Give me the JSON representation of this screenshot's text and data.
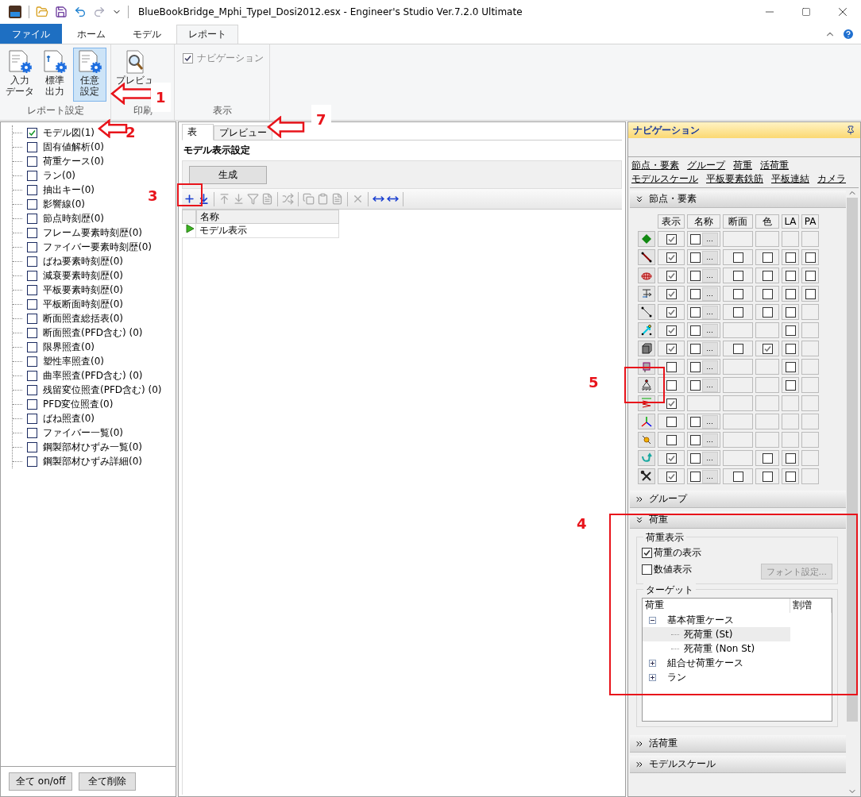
{
  "window": {
    "title": "BlueBookBridge_Mphi_TypeI_Dosi2012.esx - Engineer's Studio Ver.7.2.0 Ultimate"
  },
  "ribbon": {
    "tabs": [
      {
        "label": "ファイル",
        "kind": "file",
        "selected": false
      },
      {
        "label": "ホーム",
        "kind": "tab",
        "selected": false
      },
      {
        "label": "モデル",
        "kind": "tab",
        "selected": false
      },
      {
        "label": "レポート",
        "kind": "tab",
        "selected": true
      }
    ],
    "groups": [
      {
        "label": "レポート設定",
        "kind": "buttons",
        "buttons": [
          {
            "lines": [
              "入力",
              "データ"
            ],
            "selected": false
          },
          {
            "lines": [
              "標準",
              "出力"
            ],
            "selected": false
          },
          {
            "lines": [
              "任意",
              "設定"
            ],
            "selected": true
          }
        ]
      },
      {
        "label": "印刷",
        "kind": "buttons",
        "buttons": [
          {
            "lines": [
              "プレビュ"
            ],
            "selected": false
          }
        ]
      },
      {
        "label": "表示",
        "kind": "checkbox",
        "checkbox": {
          "label": "ナビゲーション",
          "checked": true,
          "disabled": true
        }
      }
    ]
  },
  "report_tree": {
    "items": [
      {
        "label": "モデル図(1)",
        "checked": true
      },
      {
        "label": "固有値解析(0)",
        "checked": false
      },
      {
        "label": "荷重ケース(0)",
        "checked": false
      },
      {
        "label": "ラン(0)",
        "checked": false
      },
      {
        "label": "抽出キー(0)",
        "checked": false
      },
      {
        "label": "影響線(0)",
        "checked": false
      },
      {
        "label": "節点時刻歴(0)",
        "checked": false
      },
      {
        "label": "フレーム要素時刻歴(0)",
        "checked": false
      },
      {
        "label": "ファイバー要素時刻歴(0)",
        "checked": false
      },
      {
        "label": "ばね要素時刻歴(0)",
        "checked": false
      },
      {
        "label": "減衰要素時刻歴(0)",
        "checked": false
      },
      {
        "label": "平板要素時刻歴(0)",
        "checked": false
      },
      {
        "label": "平板断面時刻歴(0)",
        "checked": false
      },
      {
        "label": "断面照査総括表(0)",
        "checked": false
      },
      {
        "label": "断面照査(PFD含む) (0)",
        "checked": false
      },
      {
        "label": "限界照査(0)",
        "checked": false
      },
      {
        "label": "塑性率照査(0)",
        "checked": false
      },
      {
        "label": "曲率照査(PFD含む) (0)",
        "checked": false
      },
      {
        "label": "残留変位照査(PFD含む) (0)",
        "checked": false
      },
      {
        "label": "PFD変位照査(0)",
        "checked": false
      },
      {
        "label": "ばね照査(0)",
        "checked": false
      },
      {
        "label": "ファイバー一覧(0)",
        "checked": false
      },
      {
        "label": "鋼製部材ひずみ一覧(0)",
        "checked": false
      },
      {
        "label": "鋼製部材ひずみ詳細(0)",
        "checked": false
      }
    ],
    "buttons": [
      "全て on/off",
      "全て削除"
    ]
  },
  "editor": {
    "tabs": [
      {
        "label": "表",
        "selected": true
      },
      {
        "label": "プレビュー",
        "selected": false
      }
    ],
    "heading": "モデル表示設定",
    "generate_button": "生成",
    "table": {
      "columns": [
        "名称"
      ],
      "rows": [
        {
          "cells": [
            "モデル表示"
          ],
          "current": true
        }
      ]
    }
  },
  "navigation": {
    "title": "ナビゲーション",
    "links": [
      "節点・要素",
      "グループ",
      "荷重",
      "活荷重",
      "モデルスケール",
      "平板要素鉄筋",
      "平板連結",
      "カメラ"
    ],
    "sections": [
      {
        "title": "節点・要素",
        "kind": "grid",
        "expanded": true
      },
      {
        "title": "グループ",
        "kind": "none",
        "expanded": false
      },
      {
        "title": "荷重",
        "kind": "load",
        "expanded": true
      },
      {
        "title": "活荷重",
        "kind": "none",
        "expanded": false
      },
      {
        "title": "モデルスケール",
        "kind": "none",
        "expanded": false
      }
    ],
    "grid": {
      "columns": [
        "表示",
        "名称",
        "断面",
        "色",
        "LA",
        "PA"
      ],
      "rows": [
        {
          "show": true,
          "name": {
            "kind": "check",
            "checked": false,
            "button": "..."
          },
          "cols": [
            {
              "kind": "empty"
            },
            {
              "kind": "empty"
            },
            {
              "kind": "empty"
            },
            {
              "kind": "empty"
            }
          ]
        },
        {
          "show": true,
          "name": {
            "kind": "check",
            "checked": false,
            "button": "..."
          },
          "cols": [
            {
              "kind": "check",
              "checked": false
            },
            {
              "kind": "check",
              "checked": false
            },
            {
              "kind": "check",
              "checked": false
            },
            {
              "kind": "check",
              "checked": false
            }
          ]
        },
        {
          "show": true,
          "name": {
            "kind": "check",
            "checked": false,
            "button": "..."
          },
          "cols": [
            {
              "kind": "check",
              "checked": false
            },
            {
              "kind": "check",
              "checked": false
            },
            {
              "kind": "check",
              "checked": false
            },
            {
              "kind": "check",
              "checked": false
            }
          ]
        },
        {
          "show": true,
          "name": {
            "kind": "check",
            "checked": false,
            "button": "..."
          },
          "cols": [
            {
              "kind": "check",
              "checked": false
            },
            {
              "kind": "check",
              "checked": false
            },
            {
              "kind": "check",
              "checked": false
            },
            {
              "kind": "check",
              "checked": false
            }
          ]
        },
        {
          "show": true,
          "name": {
            "kind": "check",
            "checked": false,
            "button": "..."
          },
          "cols": [
            {
              "kind": "check",
              "checked": false
            },
            {
              "kind": "check",
              "checked": false
            },
            {
              "kind": "check",
              "checked": false
            },
            {
              "kind": "empty"
            }
          ]
        },
        {
          "show": true,
          "name": {
            "kind": "check",
            "checked": false,
            "button": "..."
          },
          "cols": [
            {
              "kind": "empty"
            },
            {
              "kind": "empty"
            },
            {
              "kind": "check",
              "checked": false
            },
            {
              "kind": "empty"
            }
          ]
        },
        {
          "show": true,
          "name": {
            "kind": "check",
            "checked": false,
            "button": "..."
          },
          "cols": [
            {
              "kind": "check",
              "checked": false
            },
            {
              "kind": "check",
              "checked": true
            },
            {
              "kind": "check",
              "checked": false
            },
            {
              "kind": "empty"
            }
          ]
        },
        {
          "show": false,
          "name": {
            "kind": "check",
            "checked": false,
            "button": "..."
          },
          "cols": [
            {
              "kind": "empty"
            },
            {
              "kind": "empty"
            },
            {
              "kind": "check",
              "checked": false
            },
            {
              "kind": "empty"
            }
          ]
        },
        {
          "show": false,
          "name": {
            "kind": "check",
            "checked": false,
            "button": "..."
          },
          "cols": [
            {
              "kind": "empty"
            },
            {
              "kind": "empty"
            },
            {
              "kind": "check",
              "checked": false
            },
            {
              "kind": "empty"
            }
          ]
        },
        {
          "show": true,
          "name": {
            "kind": "empty"
          },
          "cols": [
            {
              "kind": "empty"
            },
            {
              "kind": "empty"
            },
            {
              "kind": "empty"
            },
            {
              "kind": "empty"
            }
          ]
        },
        {
          "show": false,
          "name": {
            "kind": "check",
            "checked": false,
            "button": "..."
          },
          "cols": [
            {
              "kind": "empty"
            },
            {
              "kind": "empty"
            },
            {
              "kind": "empty"
            },
            {
              "kind": "empty"
            }
          ]
        },
        {
          "show": false,
          "name": {
            "kind": "check",
            "checked": false,
            "button": "..."
          },
          "cols": [
            {
              "kind": "empty"
            },
            {
              "kind": "empty"
            },
            {
              "kind": "empty"
            },
            {
              "kind": "empty"
            }
          ]
        },
        {
          "show": true,
          "name": {
            "kind": "check",
            "checked": false,
            "button": "..."
          },
          "cols": [
            {
              "kind": "empty"
            },
            {
              "kind": "check",
              "checked": false
            },
            {
              "kind": "check",
              "checked": false
            },
            {
              "kind": "empty"
            }
          ]
        },
        {
          "show": true,
          "name": {
            "kind": "check",
            "checked": false,
            "button": "..."
          },
          "cols": [
            {
              "kind": "check",
              "checked": false
            },
            {
              "kind": "check",
              "checked": false
            },
            {
              "kind": "check",
              "checked": false
            },
            {
              "kind": "empty"
            }
          ]
        }
      ]
    },
    "load": {
      "display_group": "荷重表示",
      "checkboxes": [
        {
          "label": "荷重の表示",
          "checked": true
        },
        {
          "label": "数値表示",
          "checked": false
        }
      ],
      "font_button": {
        "label": "フォント設定...",
        "disabled": true
      },
      "target_group": "ターゲット",
      "columns": [
        "荷重",
        "割増"
      ],
      "items": [
        {
          "label": "基本荷重ケース",
          "expanded": true,
          "selected": false,
          "children": [
            {
              "label": "死荷重 (St)",
              "selected": true
            },
            {
              "label": "死荷重 (Non St)",
              "selected": false
            }
          ]
        },
        {
          "label": "組合せ荷重ケース",
          "expanded": false,
          "selected": false
        },
        {
          "label": "ラン",
          "expanded": false,
          "selected": false
        }
      ]
    }
  },
  "annotations": [
    {
      "label": "1"
    },
    {
      "label": "2"
    },
    {
      "label": "3"
    },
    {
      "label": "4"
    },
    {
      "label": "5"
    },
    {
      "label": "7"
    }
  ]
}
